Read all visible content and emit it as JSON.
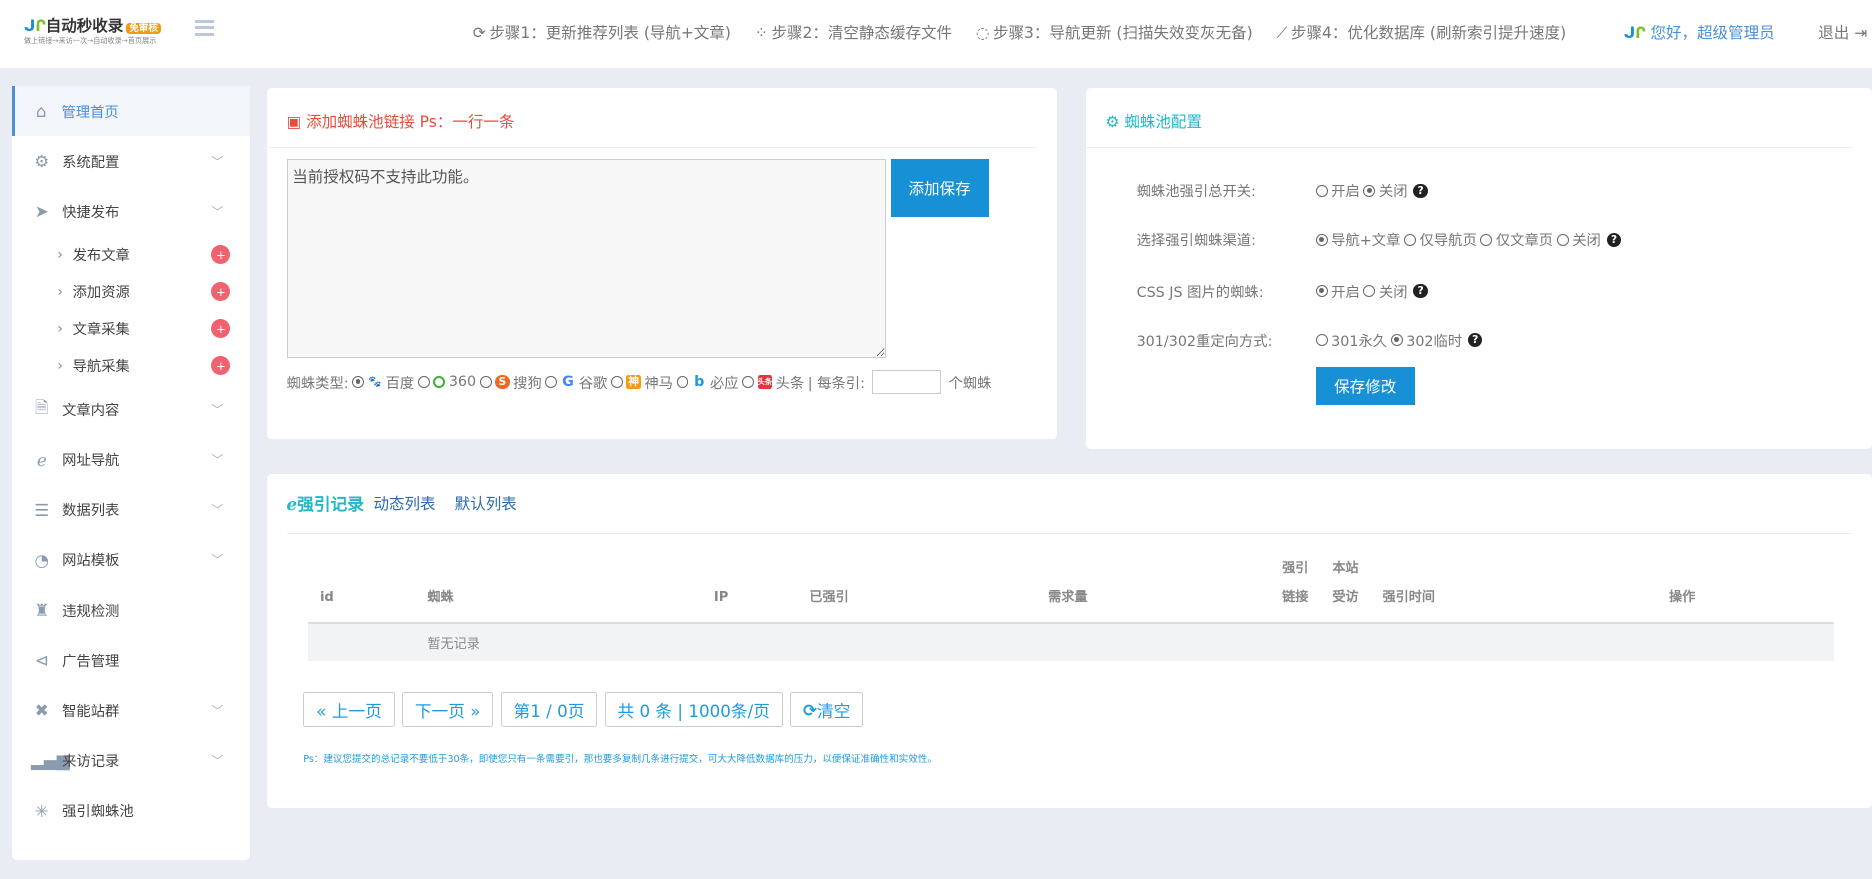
{
  "header": {
    "logo_text": "自动秒收录",
    "logo_tag": "免审核",
    "logo_slogan": "做上链接→来访一次→自动收录→首页展示",
    "steps": [
      {
        "icon": "refresh-icon",
        "label": "步骤1：更新推荐列表 (导航+文章)"
      },
      {
        "icon": "spinner-icon",
        "label": "步骤2：清空静态缓存文件"
      },
      {
        "icon": "circle-notch-icon",
        "label": "步骤3：导航更新 (扫描失效变灰无备)"
      },
      {
        "icon": "line-chart-icon",
        "label": "步骤4：优化数据库 (刷新索引提升速度)"
      }
    ],
    "greeting": "您好，超级管理员",
    "logout": "退出"
  },
  "sidebar": {
    "items": [
      {
        "label": "管理首页",
        "icon": "home-icon"
      },
      {
        "label": "系统配置",
        "icon": "gear-icon"
      },
      {
        "label": "快捷发布",
        "icon": "paper-plane-icon"
      },
      {
        "label": "文章内容",
        "icon": "file-icon"
      },
      {
        "label": "网址导航",
        "icon": "ie-icon"
      },
      {
        "label": "数据列表",
        "icon": "list-icon"
      },
      {
        "label": "网站模板",
        "icon": "dashboard-icon"
      },
      {
        "label": "违规检测",
        "icon": "robot-icon"
      },
      {
        "label": "广告管理",
        "icon": "share-icon"
      },
      {
        "label": "智能站群",
        "icon": "puzzle-icon"
      },
      {
        "label": "来访记录",
        "icon": "bar-chart-icon"
      },
      {
        "label": "强引蜘蛛池",
        "icon": "spider-icon"
      }
    ],
    "subitems": [
      "发布文章",
      "添加资源",
      "文章采集",
      "导航采集"
    ],
    "plus": "+"
  },
  "add_card": {
    "title": "添加蜘蛛池链接 Ps：一行一条",
    "textarea": "当前授权码不支持此功能。",
    "button": "添加保存",
    "type_label": "蜘蛛类型:",
    "types": [
      {
        "label": "百度",
        "checked": true
      },
      {
        "label": "360"
      },
      {
        "label": "搜狗"
      },
      {
        "label": "谷歌"
      },
      {
        "label": "神马"
      },
      {
        "label": "必应"
      },
      {
        "label": "头条"
      }
    ],
    "per_label": "| 每条引:",
    "per_value": "",
    "per_suffix": "个蜘蛛"
  },
  "config": {
    "title": "蜘蛛池配置",
    "rows": [
      {
        "label": "蜘蛛池强引总开关:",
        "options": [
          {
            "label": "开启"
          },
          {
            "label": "关闭",
            "checked": true
          }
        ]
      },
      {
        "label": "选择强引蜘蛛渠道:",
        "options": [
          {
            "label": "导航+文章",
            "checked": true
          },
          {
            "label": "仅导航页"
          },
          {
            "label": "仅文章页"
          },
          {
            "label": "关闭"
          }
        ]
      },
      {
        "label": "CSS JS 图片的蜘蛛:",
        "options": [
          {
            "label": "开启",
            "checked": true
          },
          {
            "label": "关闭"
          }
        ]
      },
      {
        "label": "301/302重定向方式:",
        "options": [
          {
            "label": "301永久"
          },
          {
            "label": "302临时",
            "checked": true
          }
        ]
      }
    ],
    "save": "保存修改"
  },
  "records": {
    "title": "强引记录",
    "tabs": [
      "动态列表",
      "默认列表"
    ],
    "columns": [
      "id",
      "蜘蛛",
      "IP",
      "已强引",
      "需求量",
      "强引\n链接",
      "本站\n受访",
      "强引时间",
      "操作"
    ],
    "empty": "暂无记录",
    "pager": [
      "« 上一页",
      "下一页 »",
      "第1 / 0页",
      "共 0 条 | 1000条/页",
      "清空"
    ],
    "note": "Ps：建议您提交的总记录不要低于30条，即使您只有一条需要引，那也要多复制几条进行提交，可大大降低数据库的压力，以便保证准确性和实效性。"
  }
}
